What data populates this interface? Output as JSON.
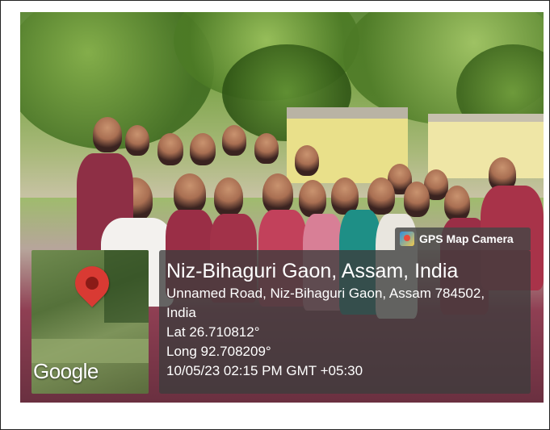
{
  "overlay": {
    "badge_label": "GPS Map Camera",
    "location_title": "Niz-Bihaguri Gaon, Assam, India",
    "address_line1": "Unnamed Road, Niz-Bihaguri Gaon, Assam 784502,",
    "address_line2": "India",
    "latitude": "Lat 26.710812°",
    "longitude": "Long 92.708209°",
    "datetime": "10/05/23 02:15 PM GMT +05:30",
    "map_label": "Google"
  },
  "colors": {
    "pin": "#d93a33",
    "overlay_bg": "#3c3c3c"
  },
  "icons": {
    "badge": "gps-map-camera-icon",
    "pin": "map-pin-icon"
  }
}
